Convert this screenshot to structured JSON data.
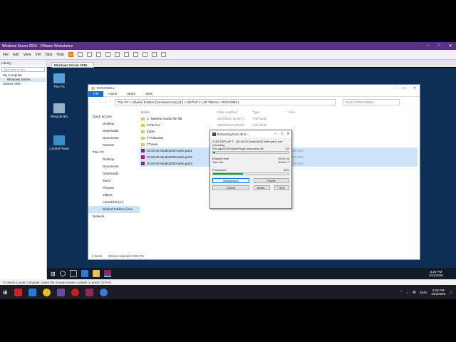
{
  "vmware": {
    "title": "Windows Server 2016 - VMware Workstation",
    "menu": [
      "File",
      "Edit",
      "View",
      "VM",
      "Tabs",
      "Help"
    ],
    "library_title": "Library",
    "library_search_placeholder": "Type here to sea...",
    "library_tree": [
      "My Computer",
      "Windows Server...",
      "Shared VMs"
    ],
    "tab_label": "Windows Server 2016",
    "status_text": "To return to your computer, move the mouse pointer outside or press Ctrl+Alt."
  },
  "desktop_icons": [
    "This PC",
    "Recycle Bin",
    "Control Panel"
  ],
  "explorer": {
    "title": "ROCKWELL",
    "ribbon": [
      "File",
      "Home",
      "Share",
      "View"
    ],
    "path": "This PC  >  Shared Folders (\\\\vmware-host) (Z:)  >  SETUP  >  LAP TRINH  >  ROCKWELL",
    "search_placeholder": "Search ROCKWELL",
    "nav": [
      {
        "label": "Quick access",
        "indent": false,
        "selected": false
      },
      {
        "label": "Desktop",
        "indent": true,
        "selected": false
      },
      {
        "label": "Downloads",
        "indent": true,
        "selected": false
      },
      {
        "label": "Documents",
        "indent": true,
        "selected": false
      },
      {
        "label": "Pictures",
        "indent": true,
        "selected": false
      },
      {
        "label": "This PC",
        "indent": false,
        "selected": false
      },
      {
        "label": "Desktop",
        "indent": true,
        "selected": false
      },
      {
        "label": "Documents",
        "indent": true,
        "selected": false
      },
      {
        "label": "Downloads",
        "indent": true,
        "selected": false
      },
      {
        "label": "Music",
        "indent": true,
        "selected": false
      },
      {
        "label": "Pictures",
        "indent": true,
        "selected": false
      },
      {
        "label": "Videos",
        "indent": true,
        "selected": false
      },
      {
        "label": "Local Disk (C:)",
        "indent": true,
        "selected": false
      },
      {
        "label": "Shared Folders (\\\\vm",
        "indent": true,
        "selected": true
      },
      {
        "label": "Network",
        "indent": false,
        "selected": false
      }
    ],
    "columns": [
      "Name",
      "Date modified",
      "Type",
      "Size"
    ],
    "files": [
      {
        "name": "3. Talkview studio file flat",
        "date": "3/20/2020 10:50 A...",
        "type": "File folder",
        "size": "",
        "kind": "folder",
        "selected": false
      },
      {
        "name": "CCW v12",
        "date": "3/23/2020 5:23 AM",
        "type": "File folder",
        "size": "",
        "kind": "folder",
        "selected": false
      },
      {
        "name": "Eplan",
        "date": "",
        "type": "",
        "size": "",
        "kind": "folder",
        "selected": false
      },
      {
        "name": "FTHistorian",
        "date": "",
        "type": "",
        "size": "",
        "kind": "folder",
        "selected": false
      },
      {
        "name": "FTView",
        "date": "",
        "type": "",
        "size": "",
        "kind": "folder",
        "selected": false
      },
      {
        "name": "30.00.00-Studio5000-Web.part1",
        "date": "",
        "type": "",
        "size": "1,000,000...",
        "kind": "rar",
        "selected": true
      },
      {
        "name": "30.00.00-Studio5000-Web.part2",
        "date": "",
        "type": "",
        "size": "1,000,000...",
        "kind": "rar",
        "selected": true
      },
      {
        "name": "30.00.00-Studio5000-Web.part3",
        "date": "",
        "type": "",
        "size": "1,000,000...",
        "kind": "rar",
        "selected": true
      }
    ],
    "status": [
      "8 items",
      "3 items selected  3.86 GB"
    ]
  },
  "dialog": {
    "title": "Extracting from 30.0...",
    "path_line": "Z:\\SETUP\\LAP T...\\30.00.00-Studio5000-Web.part1.exe",
    "action": "extracting",
    "current_file": "RSLogix5000\\StudioPlugin.resources.dll",
    "current_pct": "3%",
    "elapsed_label": "Elapsed time",
    "elapsed_value": "00:02:45",
    "left_label": "Time left",
    "left_value": "00:04:17",
    "processed_label": "Processed",
    "processed_pct": "40%",
    "progress": 0.4,
    "buttons": [
      "Background",
      "Pause",
      "Cancel",
      "Mode...",
      "Help"
    ]
  },
  "guest_clock": {
    "time": "3:26 PM",
    "date": "3/23/2020"
  },
  "host_clock": {
    "time": "3:26 PM",
    "date": "3/23/2020",
    "lang": "ENG"
  },
  "colors": {
    "vm_title": "#5b2e8c",
    "desktop": "#0d2e55",
    "progress": "#06b025",
    "accent": "#1a73c8"
  }
}
